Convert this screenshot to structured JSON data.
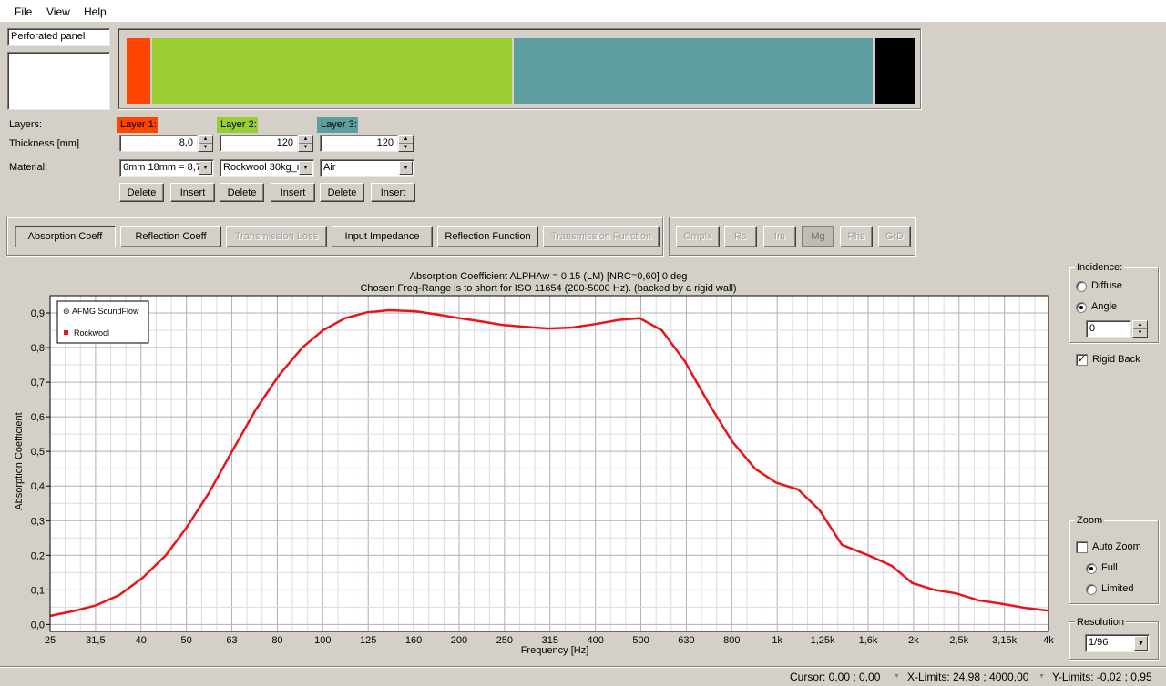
{
  "menu": [
    "File",
    "View",
    "Help"
  ],
  "structure_name": "Perforated panel",
  "layer_colors": [
    "#ff4500",
    "#9acd32",
    "#5f9ea0",
    "#000000"
  ],
  "labels": {
    "layers": "Layers:",
    "thickness": "Thickness [mm]",
    "material": "Material:"
  },
  "layers": [
    {
      "label": "Layer 1:",
      "color": "#ff4500",
      "thickness": "8,0",
      "material": "6mm 18mm  = 8,7:",
      "delete": "Delete",
      "insert": "Insert"
    },
    {
      "label": "Layer 2:",
      "color": "#9acd32",
      "thickness": "120",
      "material": "Rockwool 30kg_r",
      "delete": "Delete",
      "insert": "Insert"
    },
    {
      "label": "Layer 3:",
      "color": "#5f9ea0",
      "thickness": "120",
      "material": "Air",
      "delete": "Delete",
      "insert": "Insert"
    }
  ],
  "modes": [
    "Absorption Coeff",
    "Reflection Coeff",
    "Transmission Loss",
    "Input Impedance",
    "Reflection Function",
    "Transmission Function"
  ],
  "components": [
    "Cmplx",
    "Re",
    "Im",
    "Mg",
    "Phs",
    "GrD"
  ],
  "incidence": {
    "title": "Incidence:",
    "diffuse": "Diffuse",
    "angle": "Angle",
    "angle_value": "0"
  },
  "rigid_back": {
    "label": "Rigid Back",
    "checked": true
  },
  "zoom": {
    "title": "Zoom",
    "auto": "Auto Zoom",
    "full": "Full",
    "limited": "Limited"
  },
  "resolution": {
    "title": "Resolution",
    "value": "1/96"
  },
  "status": {
    "cursor": "Cursor: 0,00 ; 0,00",
    "xlimits": "X-Limits: 24,98 ; 4000,00",
    "ylimits": "Y-Limits: -0,02 ; 0,95"
  },
  "chart_data": {
    "type": "line",
    "title_line1": "Absorption Coefficient        ALPHAw = 0,15 (LM) [NRC=0,60]        0 deg",
    "title_line2": "Chosen Freq-Range is to short for ISO 11654 (200-5000 Hz).    (backed by a rigid wall)",
    "xlabel": "Frequency [Hz]",
    "ylabel": "Absorption Coefficient",
    "xscale": "log",
    "xlim": [
      24.98,
      4000
    ],
    "ylim": [
      -0.02,
      0.95
    ],
    "x_ticks": [
      "25",
      "31,5",
      "40",
      "50",
      "63",
      "80",
      "100",
      "125",
      "160",
      "200",
      "250",
      "315",
      "400",
      "500",
      "630",
      "800",
      "1k",
      "1,25k",
      "1,6k",
      "2k",
      "2,5k",
      "3,15k",
      "4k"
    ],
    "y_ticks": [
      "0,0",
      "0,1",
      "0,2",
      "0,3",
      "0,4",
      "0,5",
      "0,6",
      "0,7",
      "0,8",
      "0,9"
    ],
    "legend_title": "AFMG SoundFlow",
    "series": [
      {
        "name": "Rockwool",
        "color": "#e8141a",
        "x": [
          25,
          28,
          31.5,
          35.5,
          40,
          45,
          50,
          56,
          63,
          71,
          80,
          90,
          100,
          112,
          125,
          140,
          160,
          180,
          200,
          225,
          250,
          280,
          315,
          355,
          400,
          450,
          500,
          560,
          630,
          710,
          800,
          900,
          1000,
          1120,
          1250,
          1400,
          1600,
          1800,
          2000,
          2240,
          2500,
          2800,
          3150,
          3550,
          4000
        ],
        "y": [
          0.025,
          0.038,
          0.055,
          0.085,
          0.135,
          0.2,
          0.28,
          0.38,
          0.5,
          0.62,
          0.72,
          0.8,
          0.85,
          0.885,
          0.902,
          0.908,
          0.905,
          0.895,
          0.885,
          0.875,
          0.865,
          0.86,
          0.855,
          0.858,
          0.868,
          0.88,
          0.885,
          0.85,
          0.76,
          0.64,
          0.53,
          0.45,
          0.41,
          0.39,
          0.33,
          0.23,
          0.2,
          0.17,
          0.12,
          0.1,
          0.09,
          0.07,
          0.06,
          0.048,
          0.04
        ]
      }
    ]
  }
}
